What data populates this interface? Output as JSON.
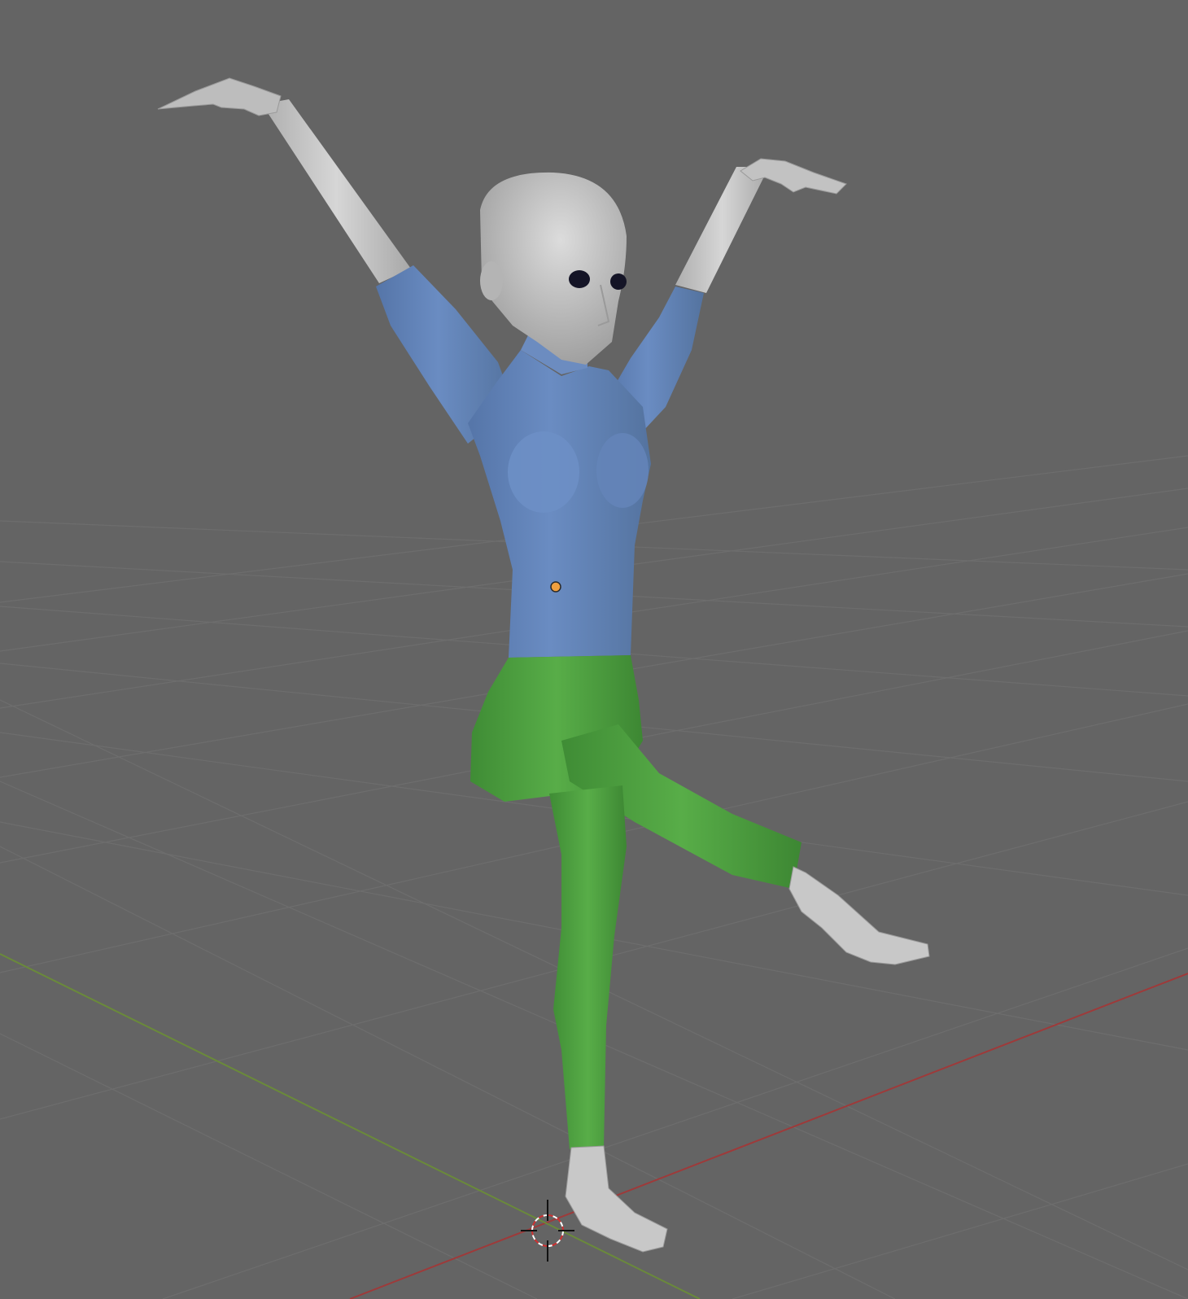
{
  "viewport": {
    "background": "#646464",
    "grid_color": "#707070",
    "x_axis_color": "#9e3a3a",
    "y_axis_color": "#6a8a3a"
  },
  "model": {
    "skin_color": "#c8c8c8",
    "shirt_color": "#5d7fb5",
    "pants_color": "#4a9a3c",
    "eye_color": "#141426",
    "origin_point_color": "#f0a040"
  },
  "cursor": {
    "icon": "3d-cursor-icon",
    "ring_color_a": "#d03030",
    "ring_color_b": "#ffffff"
  }
}
